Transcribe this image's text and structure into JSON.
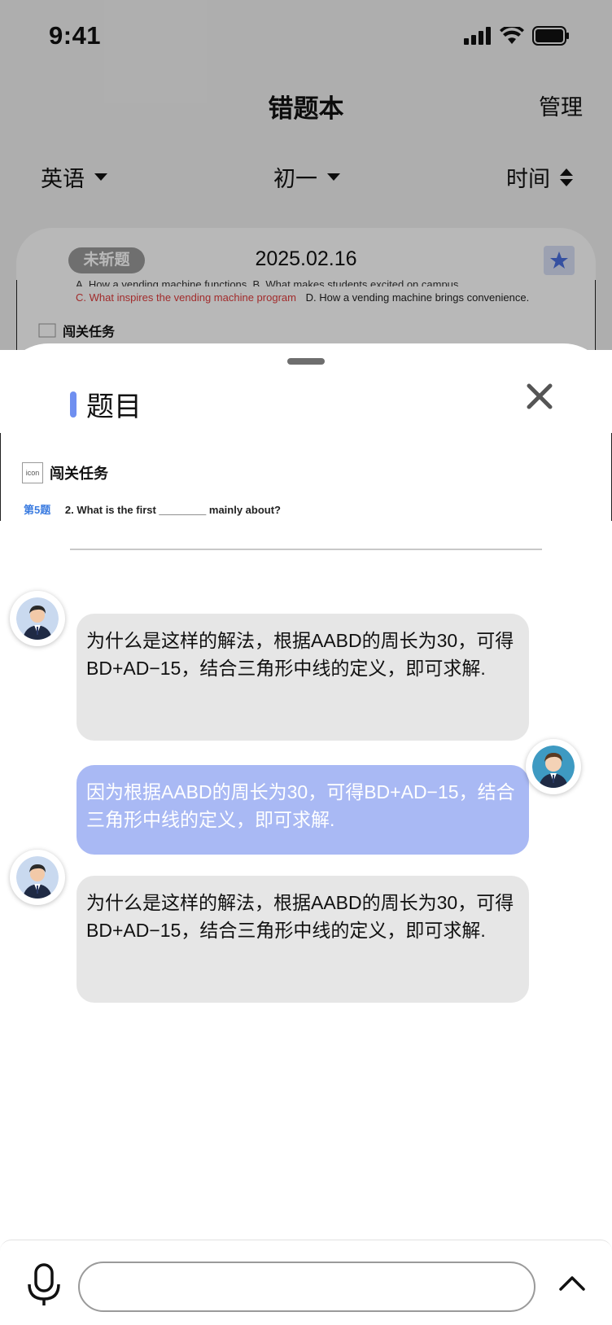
{
  "status_bar": {
    "time": "9:41",
    "icons": [
      "signal-icon",
      "wifi-icon",
      "battery-icon"
    ]
  },
  "header": {
    "title": "错题本",
    "manage": "管理"
  },
  "filters": [
    {
      "label": "英语",
      "icon": "caret-down-icon"
    },
    {
      "label": "初一",
      "icon": "caret-down-icon"
    },
    {
      "label": "时间",
      "icon": "sort-icon"
    }
  ],
  "card": {
    "badge": "未斩题",
    "date": "2025.02.16",
    "option_line_1": "A. How a vending machine functions.   B. What makes students excited on campus.",
    "option_c": "C. What inspires the vending machine program",
    "option_d": "D. How a vending machine brings convenience.",
    "task_label": "闯关任务"
  },
  "sheet": {
    "title": "题目",
    "doc": {
      "icon_text": "icon",
      "task_label": "闯关任务",
      "question_num": "第5题",
      "question_text": "2. What is the first ________ mainly about?"
    },
    "messages": [
      {
        "role": "ai",
        "text": "为什么是这样的解法，根据AABD的周长为30，可得BD+AD−15，结合三角形中线的定义，即可求解."
      },
      {
        "role": "user",
        "text": "因为根据AABD的周长为30，可得BD+AD−15，结合三角形中线的定义，即可求解."
      },
      {
        "role": "ai",
        "text": "为什么是这样的解法，根据AABD的周长为30，可得BD+AD−15，结合三角形中线的定义，即可求解."
      }
    ],
    "input": {
      "value": "",
      "placeholder": ""
    }
  },
  "colors": {
    "accent": "#6f8ff0",
    "user_bubble": "#a9b9f4",
    "ai_bubble": "#e6e6e6",
    "answer_red": "#e03c3c",
    "question_blue": "#3a7be0"
  }
}
